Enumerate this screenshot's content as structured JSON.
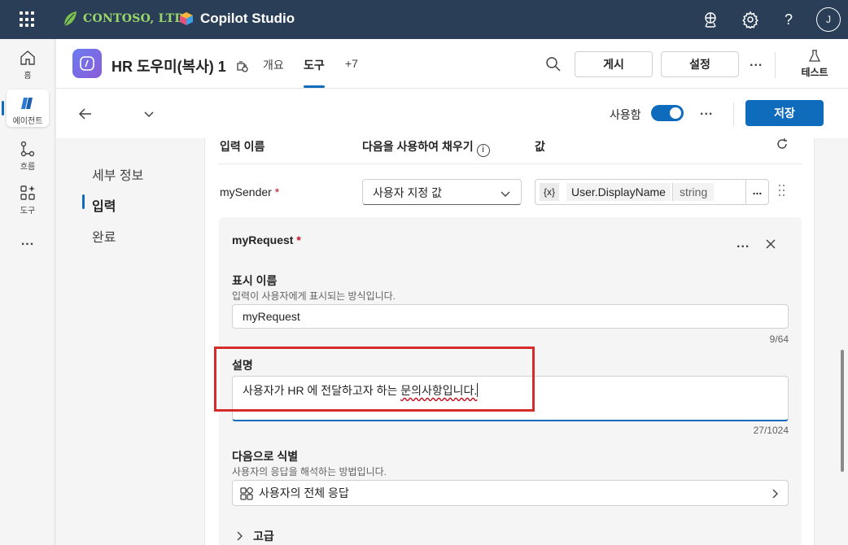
{
  "topbar": {
    "company": "CONTOSO, LTD.",
    "product": "Copilot Studio",
    "avatar_initial": "J",
    "icons": [
      "waffle-icon",
      "environment-icon",
      "settings-icon",
      "help-icon"
    ]
  },
  "rail": {
    "items": [
      {
        "label": "홈",
        "icon": "home-icon"
      },
      {
        "label": "에이전트",
        "icon": "agent-icon",
        "active": true
      },
      {
        "label": "흐름",
        "icon": "flow-icon"
      },
      {
        "label": "도구",
        "icon": "tools-icon"
      }
    ],
    "more": "..."
  },
  "header": {
    "agent_name": "HR 도우미(복사) 1",
    "tabs": [
      "개요",
      "도구",
      "+7"
    ],
    "active_tab": "도구",
    "publish": "게시",
    "settings": "설정",
    "more": "...",
    "test": "테스트"
  },
  "subbar": {
    "enabled_label": "사용함",
    "enabled": true,
    "more": "...",
    "save": "저장"
  },
  "nav": {
    "items": [
      "세부 정보",
      "입력",
      "완료"
    ],
    "active": "입력"
  },
  "inputs_table": {
    "columns": [
      "입력 이름",
      "다음을 사용하여 채우기",
      "값"
    ],
    "row": {
      "name": "mySender",
      "required_mark": "*",
      "fill_with": "사용자 지정 값",
      "value_var_chip": "{x}",
      "value_name": "User.DisplayName",
      "value_type": "string",
      "more": "..."
    }
  },
  "card": {
    "title": "myRequest",
    "required_mark": "*",
    "more": "...",
    "display_name": {
      "label": "표시 이름",
      "hint": "입력이 사용자에게 표시되는 방식입니다.",
      "value": "myRequest",
      "counter": "9/64"
    },
    "description": {
      "label": "설명",
      "value_before": "사용자가 HR 에 전달하고자 하는 ",
      "value_misspelled": "문의사항입니다.",
      "counter": "27/1024"
    },
    "identify_as": {
      "label": "다음으로 식별",
      "hint": "사용자의 응답을 해석하는 방법입니다.",
      "value": "사용자의 전체 응답"
    },
    "advanced": "고급"
  },
  "colors": {
    "topbar": "#2a3f57",
    "accent": "#0f6cbd",
    "highlight": "#d62b2b",
    "brand_green": "#9ad56a"
  }
}
